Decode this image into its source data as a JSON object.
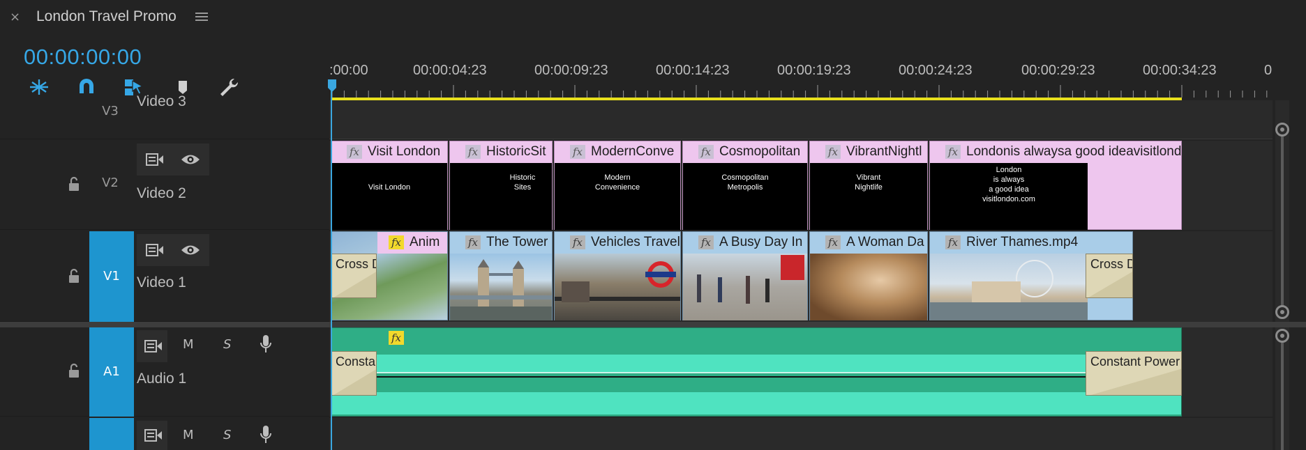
{
  "header": {
    "close_glyph": "×",
    "title": "London Travel Promo",
    "menu_icon": "hamburger-menu-icon"
  },
  "timecode": "00:00:00:00",
  "tools": [
    "snap-insert-icon",
    "magnet-snap-icon",
    "linked-selection-icon",
    "add-marker-icon",
    "wrench-settings-icon"
  ],
  "ruler": {
    "labels": [
      ":00:00",
      "00:00:04:23",
      "00:00:09:23",
      "00:00:14:23",
      "00:00:19:23",
      "00:00:24:23",
      "00:00:29:23",
      "00:00:34:23",
      "0"
    ]
  },
  "tracks": {
    "v3": {
      "label": "V3",
      "name": "Video 3"
    },
    "v2": {
      "label": "V2",
      "name": "Video 2"
    },
    "v1": {
      "label": "V1",
      "name": "Video 1"
    },
    "a1": {
      "label": "A1",
      "name": "Audio 1",
      "m": "M",
      "s": "S"
    },
    "a2": {
      "m": "M",
      "s": "S"
    }
  },
  "v2_clips": [
    {
      "title": "Visit London",
      "thumb": "Visit London"
    },
    {
      "title": "HistoricSit",
      "thumb": "Historic\nSites"
    },
    {
      "title": "ModernConve",
      "thumb": "Modern\nConvenience"
    },
    {
      "title": "Cosmopolitan",
      "thumb": "Cosmopolitan\nMetropolis"
    },
    {
      "title": "VibrantNightl",
      "thumb": "Vibrant\nNightlife"
    },
    {
      "title": "Londonis alwaysa good ideavisitlond",
      "thumb": "London\nis always\na good idea\nvisitlondon.com"
    }
  ],
  "v1_clips": [
    {
      "title": "Anim"
    },
    {
      "title": "The Tower"
    },
    {
      "title": "Vehicles Travel"
    },
    {
      "title": "A Busy Day In"
    },
    {
      "title": "A Woman Da"
    },
    {
      "title": "River Thames.mp4"
    }
  ],
  "transitions": {
    "v1_start": "Cross D",
    "v1_end": "Cross D",
    "a1_start": "Constan",
    "a1_end": "Constant Power"
  },
  "fx_label": "fx",
  "colors": {
    "accent": "#1e95cf",
    "timecode": "#36a7e6",
    "work_area": "#e8e01c",
    "title_clip": "#eec6ee",
    "video_clip": "#a9cde8",
    "audio_clip": "#2fae86"
  }
}
